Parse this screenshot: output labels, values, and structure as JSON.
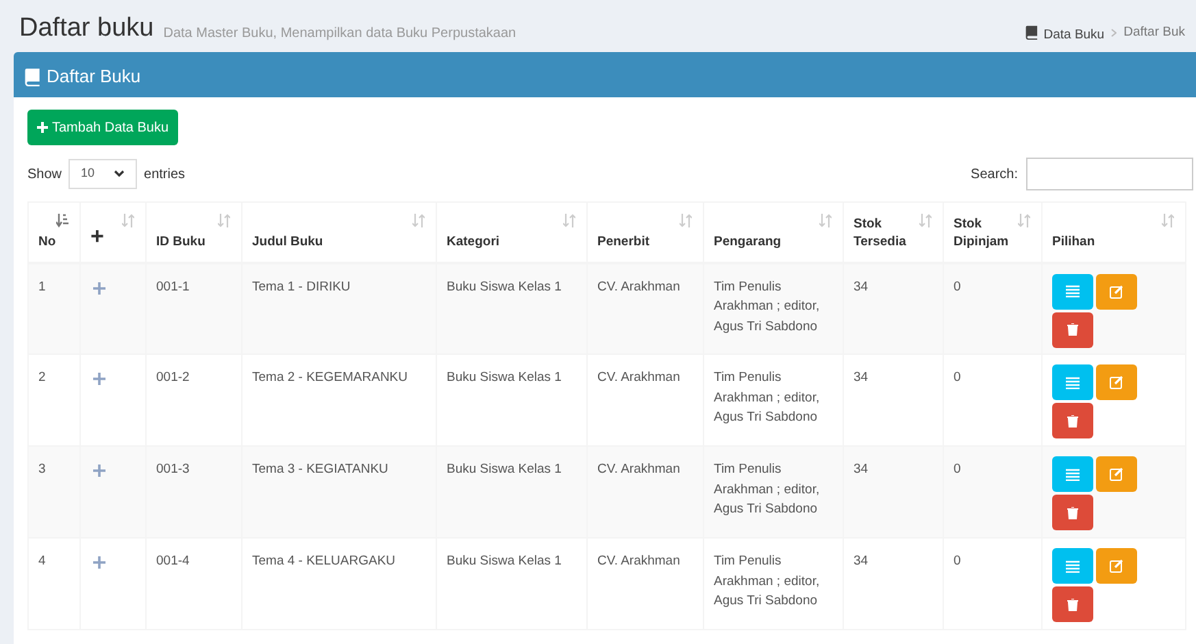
{
  "page_header": {
    "title": "Daftar buku",
    "subtitle": "Data Master Buku, Menampilkan data Buku Perpustakaan"
  },
  "breadcrumb": [
    "Data Buku",
    "Daftar Buk"
  ],
  "panel": {
    "title": "Daftar Buku"
  },
  "add_button": "Tambah Data Buku",
  "length_control": {
    "prefix": "Show",
    "value": "10",
    "suffix": "entries"
  },
  "search": {
    "label": "Search:"
  },
  "table": {
    "columns": [
      {
        "label": "No",
        "sorted": true
      },
      {
        "label": "+",
        "sorted": false
      },
      {
        "label": "ID Buku",
        "sorted": false
      },
      {
        "label": "Judul Buku",
        "sorted": false
      },
      {
        "label": "Kategori",
        "sorted": false
      },
      {
        "label": "Penerbit",
        "sorted": false
      },
      {
        "label": "Pengarang",
        "sorted": false
      },
      {
        "label": "Stok Tersedia",
        "sorted": false
      },
      {
        "label": "Stok Dipinjam",
        "sorted": false
      },
      {
        "label": "Pilihan",
        "sorted": false
      }
    ],
    "rows": [
      {
        "no": "1",
        "id": "001-1",
        "judul": "Tema 1 - DIRIKU",
        "kategori": "Buku Siswa Kelas 1",
        "penerbit": "CV. Arakhman",
        "pengarang": "Tim Penulis Arakhman ; editor, Agus Tri Sabdono",
        "tersedia": "34",
        "dipinjam": "0"
      },
      {
        "no": "2",
        "id": "001-2",
        "judul": "Tema 2 - KEGEMARANKU",
        "kategori": "Buku Siswa Kelas 1",
        "penerbit": "CV. Arakhman",
        "pengarang": "Tim Penulis Arakhman ; editor, Agus Tri Sabdono",
        "tersedia": "34",
        "dipinjam": "0"
      },
      {
        "no": "3",
        "id": "001-3",
        "judul": "Tema 3 - KEGIATANKU",
        "kategori": "Buku Siswa Kelas 1",
        "penerbit": "CV. Arakhman",
        "pengarang": "Tim Penulis Arakhman ; editor, Agus Tri Sabdono",
        "tersedia": "34",
        "dipinjam": "0"
      },
      {
        "no": "4",
        "id": "001-4",
        "judul": "Tema 4 - KELUARGAKU",
        "kategori": "Buku Siswa Kelas 1",
        "penerbit": "CV. Arakhman",
        "pengarang": "Tim Penulis Arakhman ; editor, Agus Tri Sabdono",
        "tersedia": "34",
        "dipinjam": "0"
      }
    ]
  }
}
